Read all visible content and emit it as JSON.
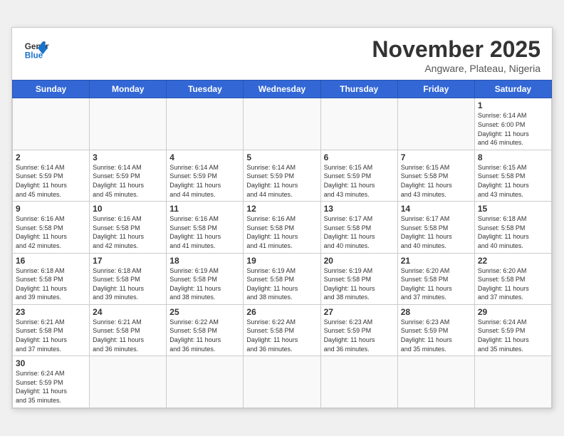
{
  "header": {
    "logo_general": "General",
    "logo_blue": "Blue",
    "month_title": "November 2025",
    "location": "Angware, Plateau, Nigeria"
  },
  "weekdays": [
    "Sunday",
    "Monday",
    "Tuesday",
    "Wednesday",
    "Thursday",
    "Friday",
    "Saturday"
  ],
  "days": {
    "1": {
      "sunrise": "6:14 AM",
      "sunset": "6:00 PM",
      "daylight": "11 hours and 46 minutes."
    },
    "2": {
      "sunrise": "6:14 AM",
      "sunset": "5:59 PM",
      "daylight": "11 hours and 45 minutes."
    },
    "3": {
      "sunrise": "6:14 AM",
      "sunset": "5:59 PM",
      "daylight": "11 hours and 45 minutes."
    },
    "4": {
      "sunrise": "6:14 AM",
      "sunset": "5:59 PM",
      "daylight": "11 hours and 44 minutes."
    },
    "5": {
      "sunrise": "6:14 AM",
      "sunset": "5:59 PM",
      "daylight": "11 hours and 44 minutes."
    },
    "6": {
      "sunrise": "6:15 AM",
      "sunset": "5:59 PM",
      "daylight": "11 hours and 43 minutes."
    },
    "7": {
      "sunrise": "6:15 AM",
      "sunset": "5:58 PM",
      "daylight": "11 hours and 43 minutes."
    },
    "8": {
      "sunrise": "6:15 AM",
      "sunset": "5:58 PM",
      "daylight": "11 hours and 43 minutes."
    },
    "9": {
      "sunrise": "6:16 AM",
      "sunset": "5:58 PM",
      "daylight": "11 hours and 42 minutes."
    },
    "10": {
      "sunrise": "6:16 AM",
      "sunset": "5:58 PM",
      "daylight": "11 hours and 42 minutes."
    },
    "11": {
      "sunrise": "6:16 AM",
      "sunset": "5:58 PM",
      "daylight": "11 hours and 41 minutes."
    },
    "12": {
      "sunrise": "6:16 AM",
      "sunset": "5:58 PM",
      "daylight": "11 hours and 41 minutes."
    },
    "13": {
      "sunrise": "6:17 AM",
      "sunset": "5:58 PM",
      "daylight": "11 hours and 40 minutes."
    },
    "14": {
      "sunrise": "6:17 AM",
      "sunset": "5:58 PM",
      "daylight": "11 hours and 40 minutes."
    },
    "15": {
      "sunrise": "6:18 AM",
      "sunset": "5:58 PM",
      "daylight": "11 hours and 40 minutes."
    },
    "16": {
      "sunrise": "6:18 AM",
      "sunset": "5:58 PM",
      "daylight": "11 hours and 39 minutes."
    },
    "17": {
      "sunrise": "6:18 AM",
      "sunset": "5:58 PM",
      "daylight": "11 hours and 39 minutes."
    },
    "18": {
      "sunrise": "6:19 AM",
      "sunset": "5:58 PM",
      "daylight": "11 hours and 38 minutes."
    },
    "19": {
      "sunrise": "6:19 AM",
      "sunset": "5:58 PM",
      "daylight": "11 hours and 38 minutes."
    },
    "20": {
      "sunrise": "6:19 AM",
      "sunset": "5:58 PM",
      "daylight": "11 hours and 38 minutes."
    },
    "21": {
      "sunrise": "6:20 AM",
      "sunset": "5:58 PM",
      "daylight": "11 hours and 37 minutes."
    },
    "22": {
      "sunrise": "6:20 AM",
      "sunset": "5:58 PM",
      "daylight": "11 hours and 37 minutes."
    },
    "23": {
      "sunrise": "6:21 AM",
      "sunset": "5:58 PM",
      "daylight": "11 hours and 37 minutes."
    },
    "24": {
      "sunrise": "6:21 AM",
      "sunset": "5:58 PM",
      "daylight": "11 hours and 36 minutes."
    },
    "25": {
      "sunrise": "6:22 AM",
      "sunset": "5:58 PM",
      "daylight": "11 hours and 36 minutes."
    },
    "26": {
      "sunrise": "6:22 AM",
      "sunset": "5:58 PM",
      "daylight": "11 hours and 36 minutes."
    },
    "27": {
      "sunrise": "6:23 AM",
      "sunset": "5:59 PM",
      "daylight": "11 hours and 36 minutes."
    },
    "28": {
      "sunrise": "6:23 AM",
      "sunset": "5:59 PM",
      "daylight": "11 hours and 35 minutes."
    },
    "29": {
      "sunrise": "6:24 AM",
      "sunset": "5:59 PM",
      "daylight": "11 hours and 35 minutes."
    },
    "30": {
      "sunrise": "6:24 AM",
      "sunset": "5:59 PM",
      "daylight": "11 hours and 35 minutes."
    }
  },
  "labels": {
    "sunrise": "Sunrise:",
    "sunset": "Sunset:",
    "daylight": "Daylight:"
  }
}
